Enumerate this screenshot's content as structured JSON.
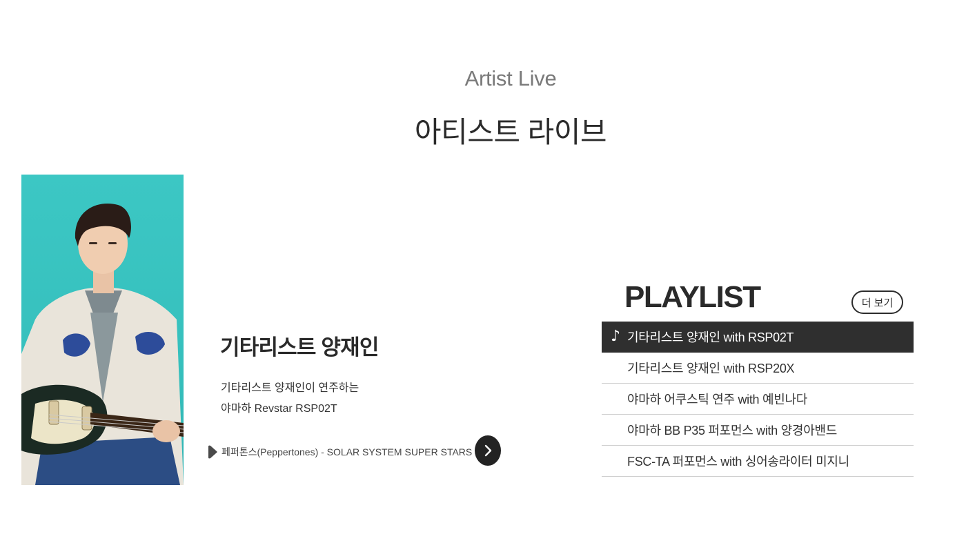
{
  "header": {
    "eyebrow": "Artist Live",
    "title": "아티스트 라이브"
  },
  "feature": {
    "artist_name": "기타리스트 양재인",
    "description_line1": "기타리스트 양재인이 연주하는",
    "description_line2": "야마하 Revstar RSP02T",
    "now_playing": "페퍼톤스(Peppertones) - SOLAR SYSTEM SUPER STARS",
    "photo_bg": "#3cc7c4"
  },
  "playlist": {
    "title": "PLAYLIST",
    "more_label": "더 보기",
    "active_color": "#2f2f2f",
    "items": [
      {
        "label": "기타리스트 양재인 with RSP02T",
        "icon": "music-note-icon"
      },
      {
        "label": "기타리스트 양재인 with RSP20X"
      },
      {
        "label": "야마하 어쿠스틱 연주 with 예빈나다"
      },
      {
        "label": "야마하 BB P35 퍼포먼스 with 양경아밴드"
      },
      {
        "label": "FSC-TA 퍼포먼스 with 싱어송라이터 미지니"
      }
    ]
  }
}
